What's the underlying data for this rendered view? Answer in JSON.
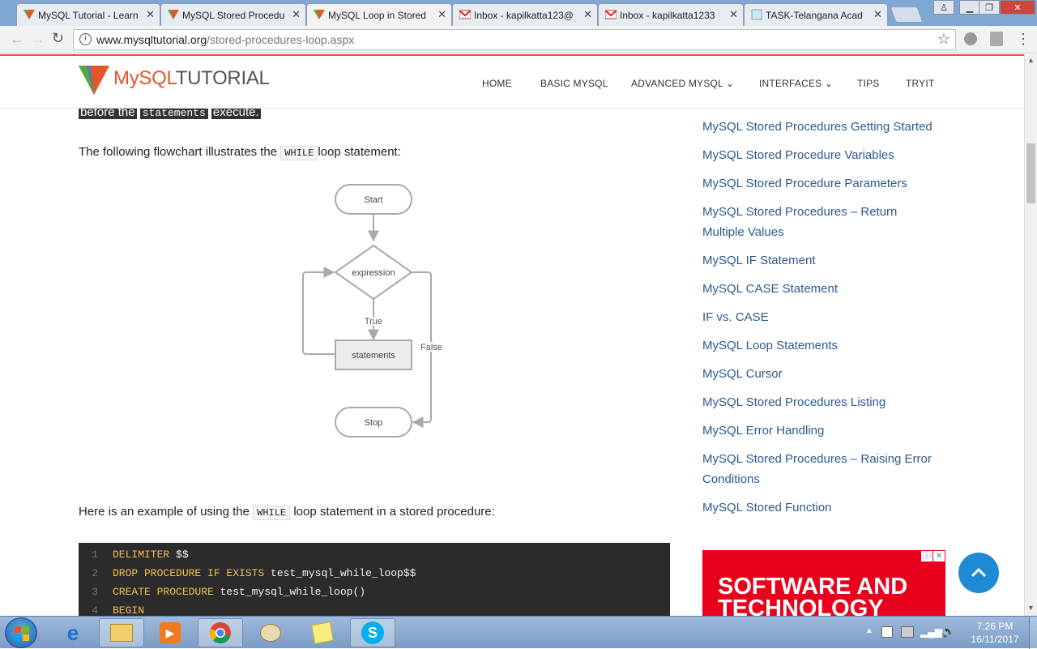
{
  "browser": {
    "tabs": [
      {
        "label": "MySQL Tutorial - Learn",
        "icon": "mysqltutorial-favicon",
        "active": false
      },
      {
        "label": "MySQL Stored Procedu",
        "icon": "mysqltutorial-favicon",
        "active": false
      },
      {
        "label": "MySQL Loop in Stored",
        "icon": "mysqltutorial-favicon",
        "active": true
      },
      {
        "label": "Inbox - kapilkatta123@",
        "icon": "gmail-favicon",
        "active": false
      },
      {
        "label": "Inbox - kapilkatta1233",
        "icon": "gmail-favicon",
        "active": false
      },
      {
        "label": "TASK-Telangana Acad",
        "icon": "page-favicon",
        "active": false
      }
    ],
    "url_host": "www.mysqltutorial.org",
    "url_path": "/stored-procedures-loop.aspx"
  },
  "site": {
    "logo_mysql": "MySQL",
    "logo_tutorial": "TUTORIAL",
    "nav": [
      "HOME",
      "BASIC MYSQL",
      "ADVANCED MYSQL",
      "INTERFACES",
      "TIPS",
      "TRYIT"
    ],
    "nav_dropdown_chevron": "⌄"
  },
  "article": {
    "cut_line": {
      "before": "before the",
      "code": "statements",
      "after": "execute."
    },
    "flow_intro": {
      "before": "The following flowchart illustrates the",
      "code": "WHILE",
      "after": "loop statement:"
    },
    "flowchart": {
      "start": "Start",
      "expression": "expression",
      "true_label": "True",
      "statements": "statements",
      "false_label": "False",
      "stop": "Stop"
    },
    "example_intro": {
      "before": "Here is an example of using the",
      "code": "WHILE",
      "after": "loop statement in a stored procedure:"
    },
    "code_lines": [
      {
        "num": "1",
        "kw": "DELIMITER",
        "rest": " $$"
      },
      {
        "num": "2",
        "kw": "DROP PROCEDURE IF EXISTS",
        "rest": " test_mysql_while_loop$$"
      },
      {
        "num": "3",
        "kw": "CREATE PROCEDURE",
        "rest": " test_mysql_while_loop()"
      },
      {
        "num": "4",
        "kw": "BEGIN",
        "rest": ""
      }
    ]
  },
  "sidebar": {
    "links": [
      [
        "MySQL Stored Procedures Getting Started"
      ],
      [
        "MySQL Stored Procedure Variables"
      ],
      [
        "MySQL Stored Procedure Parameters"
      ],
      [
        "MySQL Stored Procedures – Return",
        "Multiple Values"
      ],
      [
        "MySQL IF Statement"
      ],
      [
        "MySQL CASE Statement"
      ],
      [
        "IF vs. CASE"
      ],
      [
        "MySQL Loop Statements"
      ],
      [
        "MySQL Cursor"
      ],
      [
        "MySQL Stored Procedures Listing"
      ],
      [
        "MySQL Error Handling"
      ],
      [
        "MySQL Stored Procedures – Raising Error",
        "Conditions"
      ],
      [
        "MySQL Stored Function"
      ]
    ],
    "ad_text": "SOFTWARE AND TECHNOLOGY"
  },
  "taskbar": {
    "time": "7:26 PM",
    "date": "16/11/2017",
    "apps": [
      "start-orb",
      "internet-explorer-icon",
      "file-explorer-icon",
      "media-player-icon",
      "chrome-icon",
      "paint-icon",
      "sticky-notes-icon",
      "skype-icon"
    ]
  },
  "colors": {
    "accent": "#e4562a",
    "link": "#2b5a8f",
    "ad_red": "#e8001c",
    "scroll_top": "#1e8ad6"
  }
}
